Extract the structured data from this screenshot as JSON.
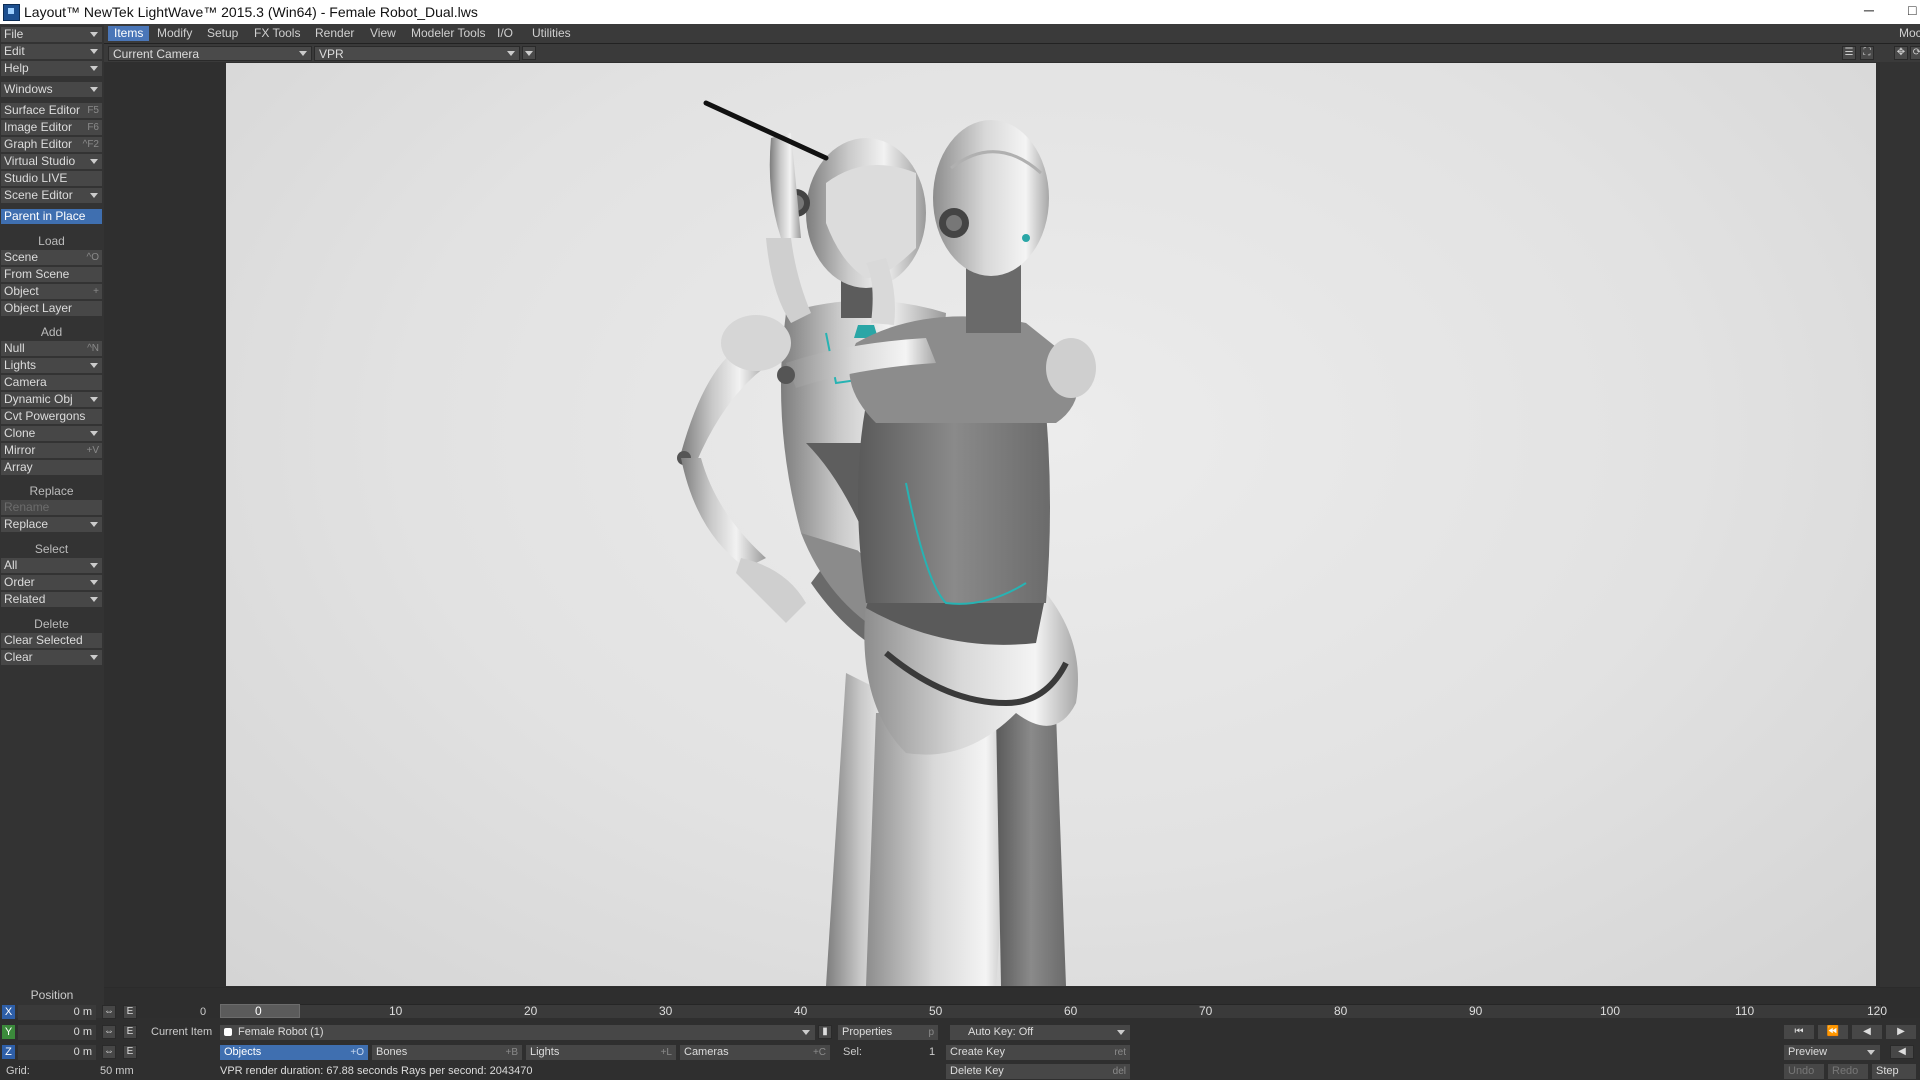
{
  "window": {
    "title": "Layout™ NewTek LightWave™ 2015.3 (Win64) - Female Robot_Dual.lws",
    "minimize_glyph": "─",
    "maximize_glyph": "□"
  },
  "tabs": [
    {
      "label": "Items",
      "active": true
    },
    {
      "label": "Modify"
    },
    {
      "label": "Setup"
    },
    {
      "label": "FX Tools"
    },
    {
      "label": "Render"
    },
    {
      "label": "View"
    },
    {
      "label": "Modeler Tools"
    },
    {
      "label": "I/O"
    },
    {
      "label": "Utilities"
    }
  ],
  "tab_right_label": "Moc",
  "left_menu": {
    "file": "File",
    "edit": "Edit",
    "help": "Help",
    "windows": "Windows",
    "surface_editor": {
      "label": "Surface Editor",
      "shortcut": "F5"
    },
    "image_editor": {
      "label": "Image Editor",
      "shortcut": "F6"
    },
    "graph_editor": {
      "label": "Graph Editor",
      "shortcut": "^F2"
    },
    "virtual_studio": "Virtual Studio",
    "studio_live": "Studio LIVE",
    "scene_editor": "Scene Editor",
    "parent_in_place": "Parent in Place",
    "load_header": "Load",
    "scene": {
      "label": "Scene",
      "shortcut": "^O"
    },
    "from_scene": "From Scene",
    "object": {
      "label": "Object",
      "shortcut": "+"
    },
    "object_layer": "Object Layer",
    "add_header": "Add",
    "null": {
      "label": "Null",
      "shortcut": "^N"
    },
    "lights": "Lights",
    "camera": "Camera",
    "dynamic_obj": "Dynamic Obj",
    "cvt_powergons": "Cvt Powergons",
    "clone": "Clone",
    "mirror": {
      "label": "Mirror",
      "shortcut": "+V"
    },
    "array": "Array",
    "replace_header": "Replace",
    "rename": "Rename",
    "replace": "Replace",
    "select_header": "Select",
    "all": "All",
    "order": "Order",
    "related": "Related",
    "delete_header": "Delete",
    "clear_selected": "Clear Selected",
    "clear": "Clear"
  },
  "viewport": {
    "camera_select": "Current Camera",
    "render_mode": "VPR"
  },
  "timeline": {
    "position_label": "Position",
    "start_frame": "0",
    "current_frame": "0",
    "ticks": [
      "10",
      "20",
      "30",
      "40",
      "50",
      "60",
      "70",
      "80",
      "90",
      "100",
      "110",
      "120"
    ]
  },
  "bottom": {
    "x": {
      "axis": "X",
      "value": "0 m"
    },
    "y": {
      "axis": "Y",
      "value": "0 m"
    },
    "z": {
      "axis": "Z",
      "value": "0 m"
    },
    "grid_label": "Grid:",
    "grid_value": "50 mm",
    "e_label": "E",
    "current_item_label": "Current Item",
    "current_item_value": "Female Robot (1)",
    "properties": {
      "label": "Properties",
      "shortcut": "p"
    },
    "auto_key": "Auto Key: Off",
    "objects": {
      "label": "Objects",
      "shortcut": "+O"
    },
    "bones": {
      "label": "Bones",
      "shortcut": "+B"
    },
    "lights": {
      "label": "Lights",
      "shortcut": "+L"
    },
    "cameras": {
      "label": "Cameras",
      "shortcut": "+C"
    },
    "sel_label": "Sel:",
    "sel_value": "1",
    "create_key": {
      "label": "Create Key",
      "shortcut": "ret"
    },
    "delete_key": {
      "label": "Delete Key",
      "shortcut": "del"
    },
    "status": "VPR render duration: 67.88 seconds  Rays per second: 2043470",
    "preview": "Preview",
    "undo": "Undo",
    "redo": "Redo",
    "step": "Step"
  },
  "colors": {
    "accent": "#3f6fb0",
    "panel": "#333333",
    "viewport_bg": "#e6e6e6",
    "robot_trim": "#27b3b3"
  }
}
